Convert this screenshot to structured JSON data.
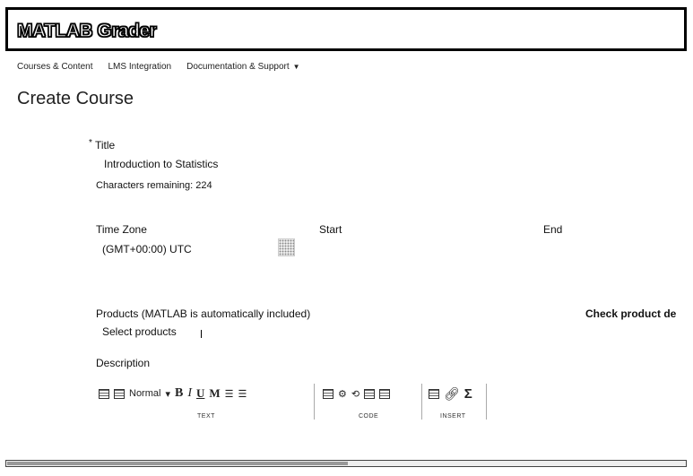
{
  "app": {
    "logo": "MATLAB Grader"
  },
  "nav": {
    "items": [
      {
        "label": "Courses & Content"
      },
      {
        "label": "LMS Integration"
      },
      {
        "label": "Documentation & Support"
      }
    ]
  },
  "page": {
    "title": "Create Course"
  },
  "form": {
    "required_mark": "*",
    "title_label": "Title",
    "title_value": "Introduction to Statistics",
    "chars_remaining": "Characters remaining: 224",
    "timezone_label": "Time Zone",
    "timezone_value": "(GMT+00:00) UTC",
    "start_label": "Start",
    "end_label": "End",
    "products_label": "Products (MATLAB is automatically included)",
    "products_value": "Select products",
    "check_product": "Check product de",
    "description_label": "Description"
  },
  "toolbar": {
    "style_value": "Normal",
    "bold": "B",
    "italic": "I",
    "underline": "U",
    "m": "M",
    "groups": {
      "text": "TEXT",
      "code": "CODE",
      "insert": "INSERT"
    },
    "sigma": "Σ"
  }
}
